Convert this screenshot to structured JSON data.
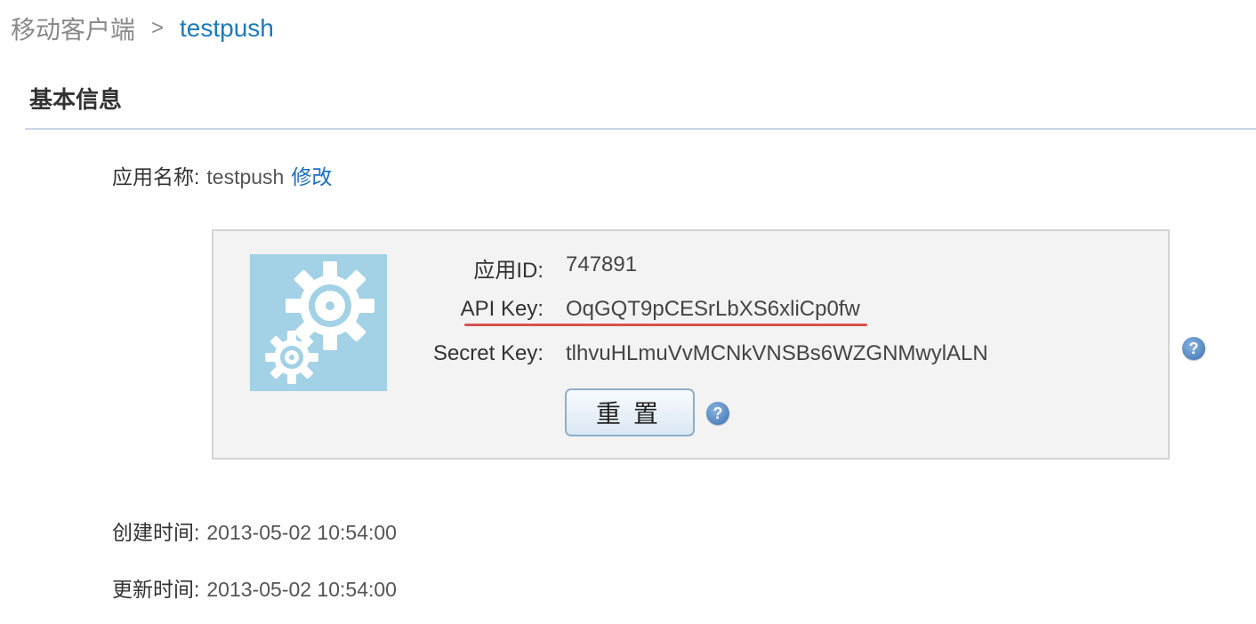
{
  "breadcrumb": {
    "parent": "移动客户端",
    "separator": ">",
    "current": "testpush"
  },
  "section": {
    "title": "基本信息"
  },
  "app_name": {
    "label": "应用名称:",
    "value": "testpush",
    "edit_link": "修改"
  },
  "keys": {
    "app_id_label": "应用ID:",
    "app_id_value": "747891",
    "api_key_label": "API Key:",
    "api_key_value": "OqGQT9pCESrLbXS6xliCp0fw",
    "secret_key_label": "Secret Key:",
    "secret_key_value": "tlhvuHLmuVvMCNkVNSBs6WZGNMwylALN",
    "reset_button": "重置",
    "app_icon": "gears-icon",
    "help_icon": "question-mark-icon"
  },
  "created": {
    "label": "创建时间:",
    "value": "2013-05-02 10:54:00"
  },
  "updated": {
    "label": "更新时间:",
    "value": "2013-05-02 10:54:00"
  },
  "colors": {
    "link": "#1a6fc0",
    "breadcrumb_current": "#1a7bbf",
    "panel_bg": "#f3f3f3",
    "icon_bg": "#a3d1e6",
    "highlight_underline": "#d9534f"
  }
}
